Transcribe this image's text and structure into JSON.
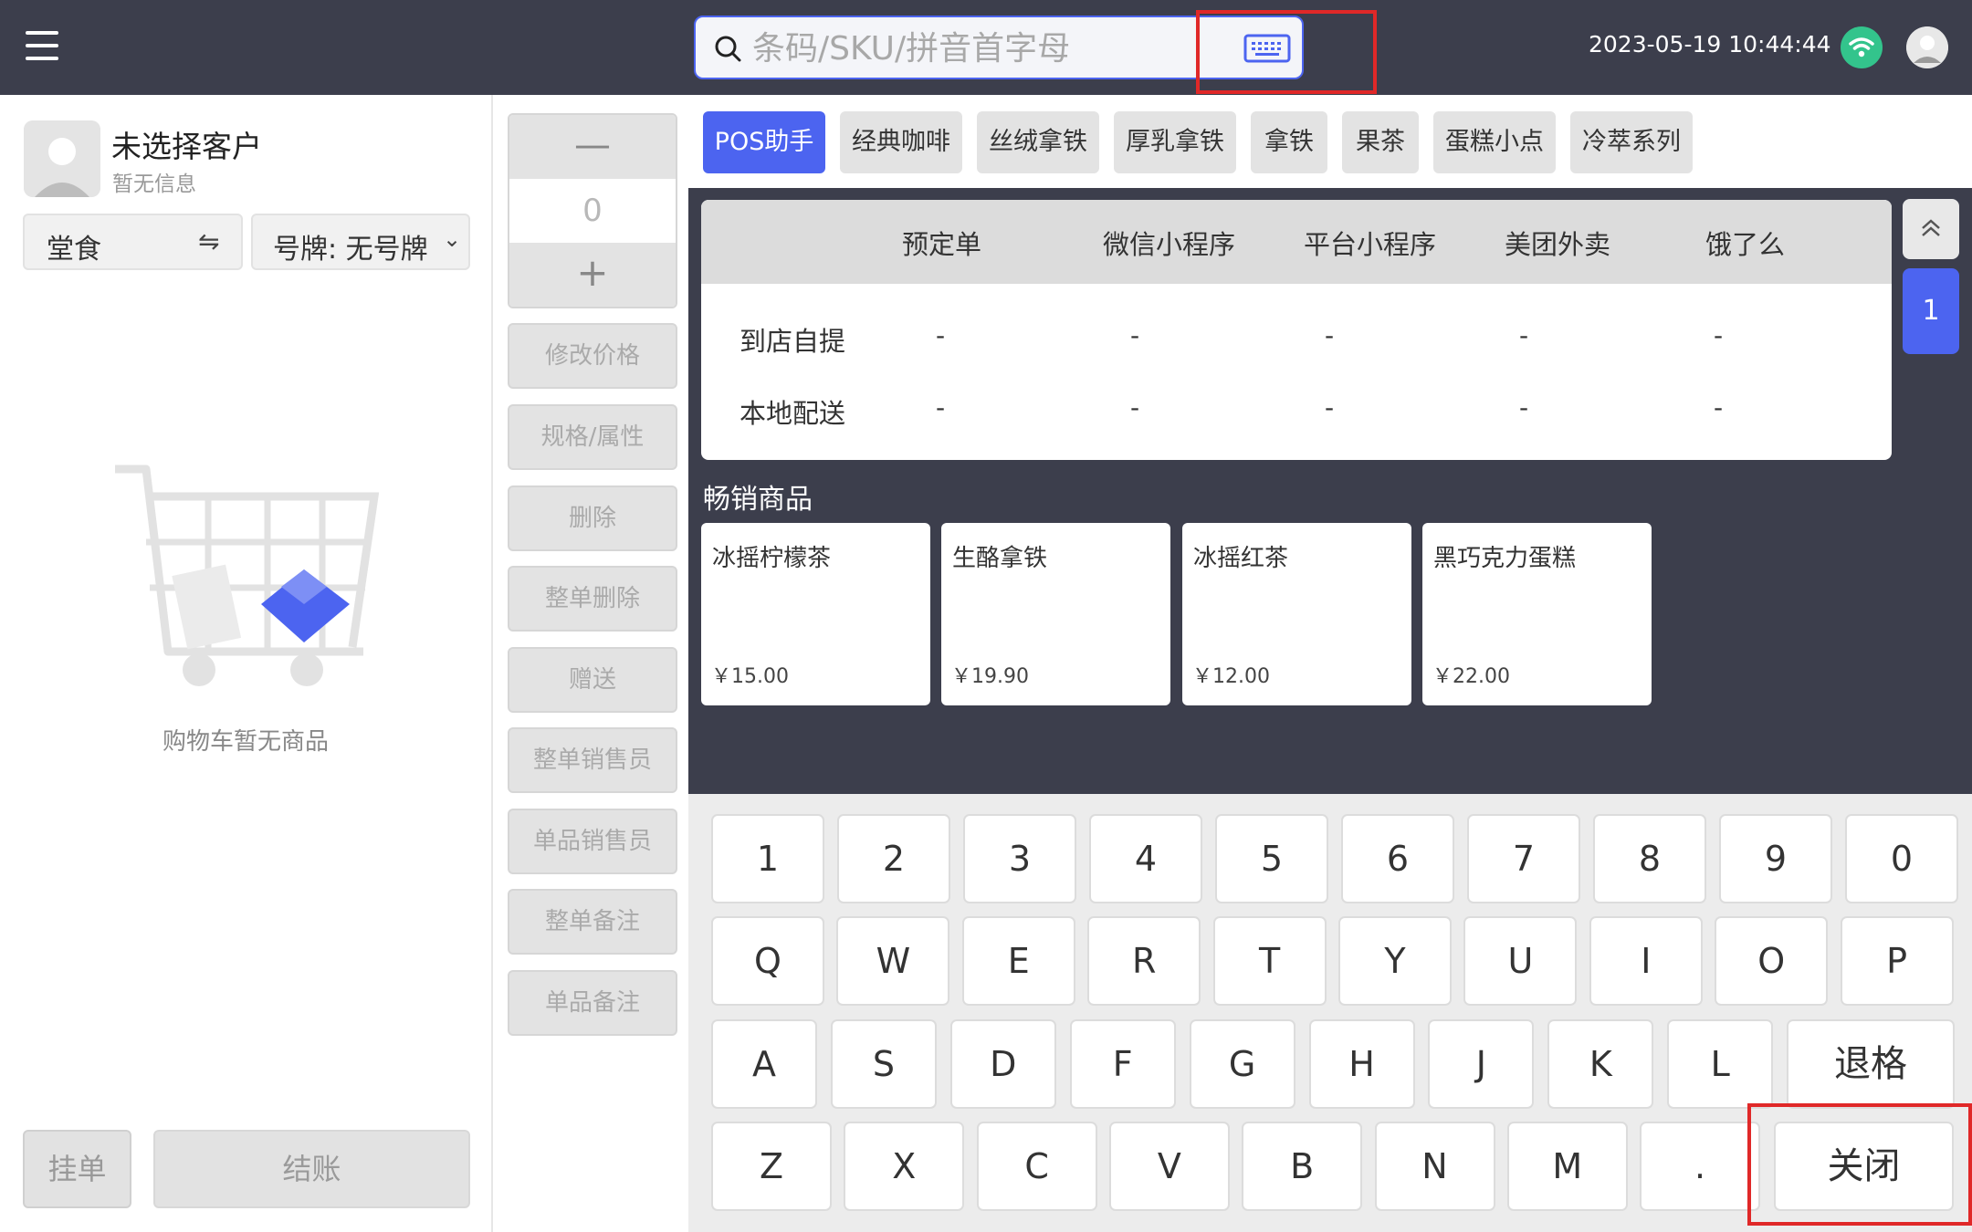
{
  "header": {
    "search_placeholder": "条码/SKU/拼音首字母",
    "datetime": "2023-05-19 10:44:44"
  },
  "customer": {
    "name": "未选择客户",
    "info": "暂无信息",
    "dine_mode": "堂食",
    "plate": "号牌:   无号牌"
  },
  "cart": {
    "empty_text": "购物车暂无商品",
    "hold_label": "挂单",
    "checkout_label": "结账"
  },
  "quantity": {
    "minus": "—",
    "value": "0",
    "plus": "+"
  },
  "actions": [
    "修改价格",
    "规格/属性",
    "删除",
    "整单删除",
    "赠送",
    "整单销售员",
    "单品销售员",
    "整单备注",
    "单品备注"
  ],
  "categories": [
    "POS助手",
    "经典咖啡",
    "丝绒拿铁",
    "厚乳拿铁",
    "拿铁",
    "果茶",
    "蛋糕小点",
    "冷萃系列"
  ],
  "orders": {
    "columns": [
      "预定单",
      "微信小程序",
      "平台小程序",
      "美团外卖",
      "饿了么"
    ],
    "rows": [
      {
        "label": "到店自提",
        "cells": [
          "-",
          "-",
          "-",
          "-",
          "-"
        ]
      },
      {
        "label": "本地配送",
        "cells": [
          "-",
          "-",
          "-",
          "-",
          "-"
        ]
      }
    ]
  },
  "page_number": "1",
  "bestsellers": {
    "title": "畅销商品",
    "items": [
      {
        "name": "冰摇柠檬茶",
        "price": "￥15.00"
      },
      {
        "name": "生酪拿铁",
        "price": "￥19.90"
      },
      {
        "name": "冰摇红茶",
        "price": "￥12.00"
      },
      {
        "name": "黑巧克力蛋糕",
        "price": "￥22.00"
      }
    ]
  },
  "keyboard": {
    "row1": [
      "1",
      "2",
      "3",
      "4",
      "5",
      "6",
      "7",
      "8",
      "9",
      "0"
    ],
    "row2": [
      "Q",
      "W",
      "E",
      "R",
      "T",
      "Y",
      "U",
      "I",
      "O",
      "P"
    ],
    "row3": [
      "A",
      "S",
      "D",
      "F",
      "G",
      "H",
      "J",
      "K",
      "L"
    ],
    "backspace": "退格",
    "row4": [
      "Z",
      "X",
      "C",
      "V",
      "B",
      "N",
      "M",
      "."
    ],
    "close": "关闭"
  },
  "colors": {
    "accent": "#4c64f0",
    "topbar": "#3c3e4c",
    "wifi": "#33c48c",
    "highlight": "#e02828"
  },
  "icons": [
    "menu-icon",
    "search-icon",
    "keyboard-icon",
    "wifi-icon",
    "user-avatar-icon",
    "swap-icon",
    "chevron-down-icon",
    "chevron-up-icon",
    "cart-icon"
  ]
}
